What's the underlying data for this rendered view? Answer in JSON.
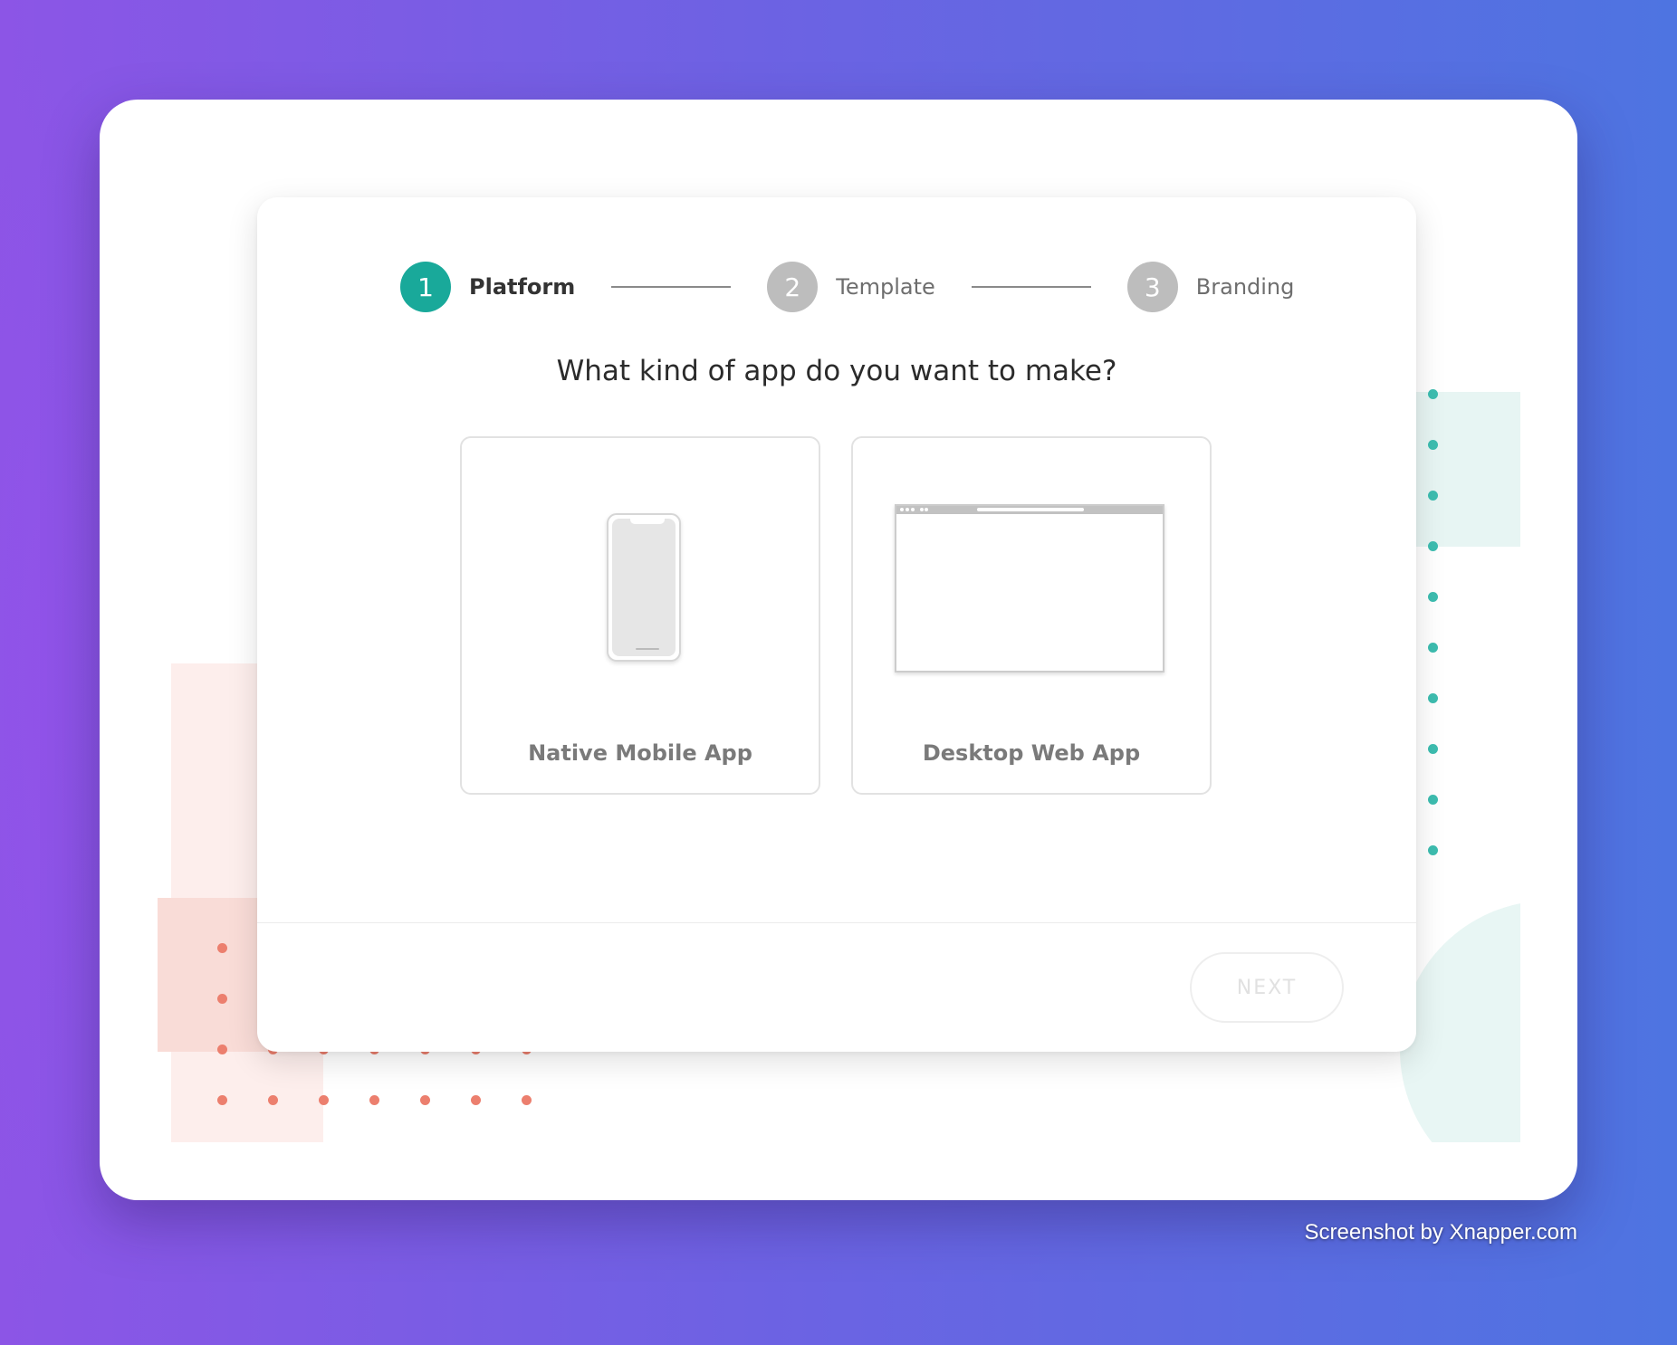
{
  "wizard": {
    "steps": [
      {
        "number": "1",
        "label": "Platform",
        "active": true
      },
      {
        "number": "2",
        "label": "Template",
        "active": false
      },
      {
        "number": "3",
        "label": "Branding",
        "active": false
      }
    ],
    "question": "What kind of app do you want to make?",
    "options": [
      {
        "label": "Native Mobile App",
        "icon": "mobile-phone-icon"
      },
      {
        "label": "Desktop Web App",
        "icon": "browser-window-icon"
      }
    ],
    "next_label": "NEXT",
    "next_enabled": false
  },
  "watermark": "Screenshot by Xnapper.com",
  "colors": {
    "accent": "#19a99a",
    "step_inactive": "#bdbdbd",
    "decor_coral": "#ec7f6e",
    "decor_teal": "#3dbdb0"
  }
}
